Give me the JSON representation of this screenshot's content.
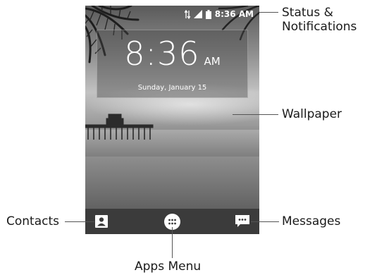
{
  "status_bar": {
    "time": "8:36 AM",
    "icons": [
      "sync-icon",
      "signal-icon",
      "battery-icon"
    ]
  },
  "clock": {
    "time": "8:36",
    "ampm": "AM",
    "date": "Sunday, January 15"
  },
  "dock": {
    "icons": [
      "contacts-icon",
      "apps-menu-icon",
      "messages-icon"
    ]
  },
  "callouts": {
    "status_line1": "Status &",
    "status_line2": "Notifications",
    "wallpaper": "Wallpaper",
    "contacts": "Contacts",
    "messages": "Messages",
    "apps_menu": "Apps Menu"
  }
}
